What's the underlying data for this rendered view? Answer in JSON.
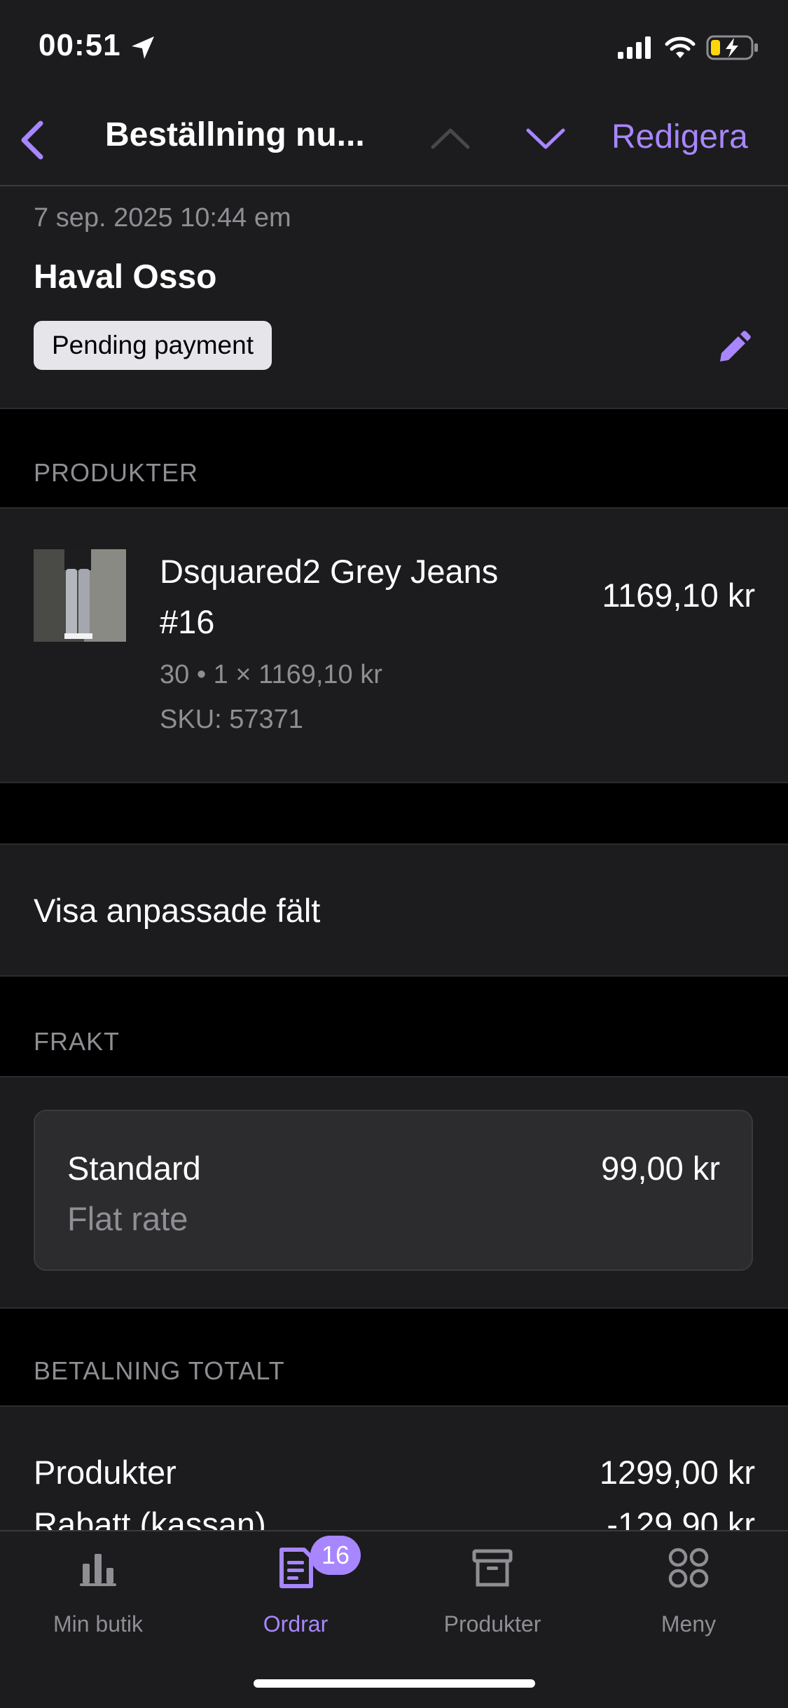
{
  "status_bar": {
    "time": "00:51"
  },
  "nav": {
    "title": "Beställning nu...",
    "edit_label": "Redigera"
  },
  "order": {
    "date": "7 sep. 2025 10:44 em",
    "customer": "Haval Osso",
    "status": "Pending payment"
  },
  "products_section": {
    "label": "PRODUKTER",
    "item": {
      "name": "Dsquared2 Grey Jeans #16",
      "price": "1169,10 kr",
      "meta": "30 • 1 × 1169,10 kr",
      "sku": "SKU: 57371"
    }
  },
  "custom_fields": {
    "label": "Visa anpassade fält"
  },
  "shipping_section": {
    "label": "FRAKT",
    "method": "Standard",
    "detail": "Flat rate",
    "price": "99,00 kr"
  },
  "payment_section": {
    "label": "BETALNING TOTALT",
    "rows": [
      {
        "label": "Produkter",
        "value": "1299,00 kr"
      },
      {
        "label": "Rabatt (kassan)",
        "value": "-129,90 kr"
      }
    ]
  },
  "tabbar": {
    "tabs": [
      {
        "label": "Min butik"
      },
      {
        "label": "Ordrar",
        "badge": "16"
      },
      {
        "label": "Produkter"
      },
      {
        "label": "Meny"
      }
    ]
  },
  "colors": {
    "accent": "#a886ff",
    "background": "#000000",
    "surface": "#1c1c1e"
  }
}
